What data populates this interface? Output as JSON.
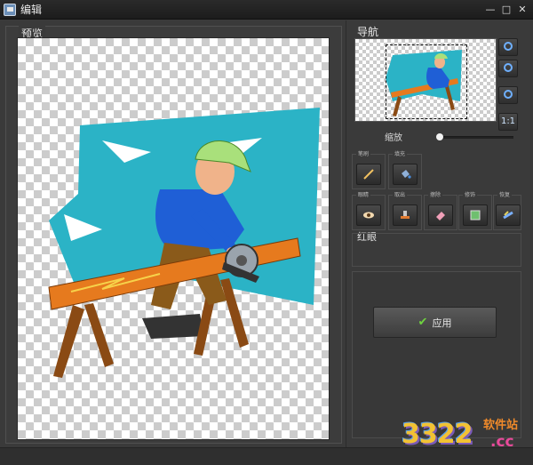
{
  "window": {
    "title": "编辑",
    "minimize": "—",
    "maximize": "□",
    "close": "✕",
    "icon": "app-icon"
  },
  "preview": {
    "title": "预览"
  },
  "navigator": {
    "title": "导航",
    "zoom_in": "zoom-in-icon",
    "zoom_out": "zoom-out-icon",
    "zoom_fit": "zoom-fit-icon",
    "actual_size": "1:1"
  },
  "zoom": {
    "label": "缩放",
    "slider_fraction": 0.03
  },
  "tools": {
    "group1": {
      "label": "笔刷",
      "icon": "brush-icon"
    },
    "group2": {
      "label": "填充",
      "icon": "fill-bucket-icon"
    },
    "group3": {
      "label": "眼睛",
      "icon": "eye-icon"
    },
    "group4": {
      "label": "取出",
      "icon": "stamp-icon"
    },
    "group5": {
      "label": "擦除",
      "icon": "eraser-icon"
    },
    "group6": {
      "label": "修饰",
      "icon": "retouch-icon"
    },
    "group7": {
      "label": "恢复",
      "icon": "restore-icon"
    }
  },
  "redeye": {
    "label": "红眼"
  },
  "apply": {
    "label": "应用",
    "icon": "check-icon"
  },
  "watermark": {
    "number": "3322",
    "site_cn": "软件站",
    "domain": ".cc"
  },
  "colors": {
    "background": "#3a3a3a",
    "check_green": "#6fd33f",
    "accent_cyan": "#2bb3c6"
  }
}
